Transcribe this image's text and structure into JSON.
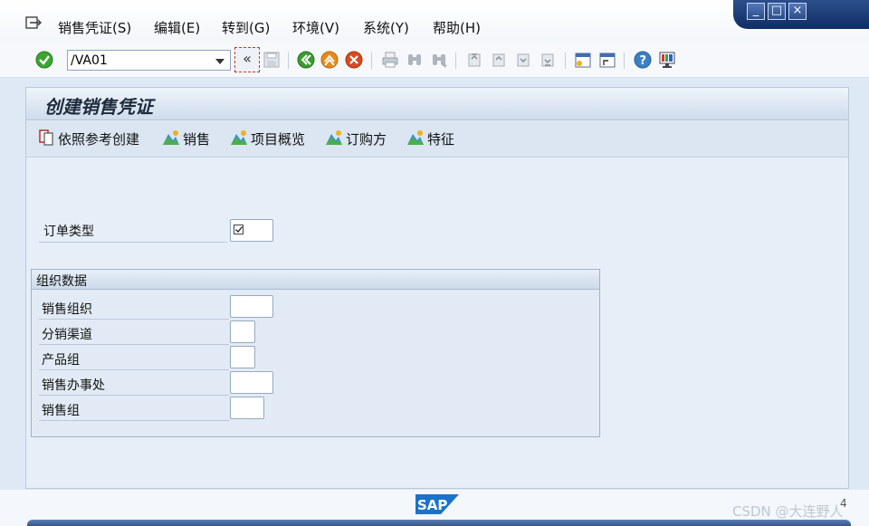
{
  "menu": {
    "items": [
      "销售凭证(S)",
      "编辑(E)",
      "转到(G)",
      "环境(V)",
      "系统(Y)",
      "帮助(H)"
    ]
  },
  "window_controls": {
    "minimize": "_",
    "maximize": "□",
    "close": "×"
  },
  "toolbar": {
    "command_value": "/VA01",
    "enter_label": "«"
  },
  "screen": {
    "title": "创建销售凭证",
    "buttons": [
      {
        "label": "依照参考创建",
        "icon": "create-with-reference-icon"
      },
      {
        "label": "销售",
        "icon": "sales-icon"
      },
      {
        "label": "项目概览",
        "icon": "item-overview-icon"
      },
      {
        "label": "订购方",
        "icon": "sold-to-party-icon"
      },
      {
        "label": "特征",
        "icon": "characteristics-icon"
      }
    ]
  },
  "fields": {
    "order_type": {
      "label": "订单类型",
      "value": ""
    }
  },
  "org_group": {
    "title": "组织数据",
    "fields": [
      {
        "label": "销售组织",
        "value": ""
      },
      {
        "label": "分销渠道",
        "value": ""
      },
      {
        "label": "产品组",
        "value": ""
      },
      {
        "label": "销售办事处",
        "value": ""
      },
      {
        "label": "销售组",
        "value": ""
      }
    ]
  },
  "footer": {
    "logo_text": "SAP",
    "watermark": "CSDN @大连野人",
    "corner_glyph": "4"
  },
  "colors": {
    "accent": "#2d4f88",
    "ok_green": "#3aa52f",
    "cancel_red": "#d64b1f",
    "back_green": "#3d9b2f",
    "exit_orange": "#e58a1a"
  }
}
